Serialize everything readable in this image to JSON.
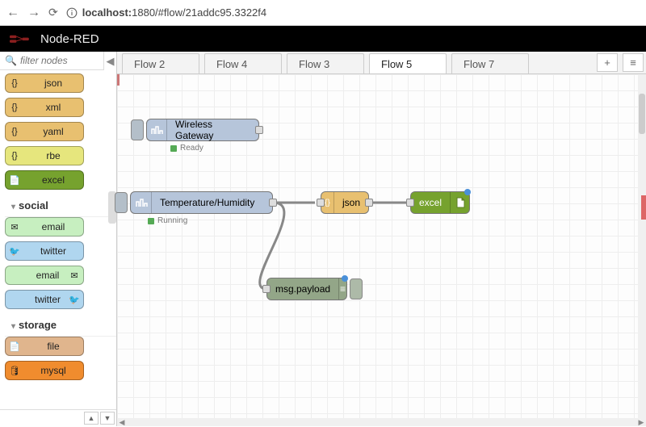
{
  "browser": {
    "url_prefix": "localhost:",
    "url_rest": "1880/#flow/21addc95.3322f4"
  },
  "app": {
    "title": "Node-RED"
  },
  "palette": {
    "search_placeholder": "filter nodes",
    "nodes1": [
      {
        "label": "json",
        "color": "#e8c070"
      },
      {
        "label": "xml",
        "color": "#e8c070"
      },
      {
        "label": "yaml",
        "color": "#e8c070"
      },
      {
        "label": "rbe",
        "color": "#e6e67d"
      },
      {
        "label": "excel",
        "color": "#76a22e"
      }
    ],
    "cat_social": "social",
    "social": [
      {
        "label": "email",
        "dir": "out",
        "color": "#c7efc0"
      },
      {
        "label": "twitter",
        "dir": "out",
        "color": "#b0d6ef"
      },
      {
        "label": "email",
        "dir": "in",
        "color": "#c7efc0"
      },
      {
        "label": "twitter",
        "dir": "in",
        "color": "#b0d6ef"
      }
    ],
    "cat_storage": "storage",
    "storage": [
      {
        "label": "file",
        "color": "#e0b58d"
      },
      {
        "label": "mysql",
        "color": "#f08c2e"
      }
    ]
  },
  "tabs": {
    "list": [
      {
        "label": "Flow 2",
        "active": false
      },
      {
        "label": "Flow 4",
        "active": false
      },
      {
        "label": "Flow 3",
        "active": false
      },
      {
        "label": "Flow 5",
        "active": true
      },
      {
        "label": "Flow 7",
        "active": false
      }
    ]
  },
  "flow": {
    "gateway": {
      "label": "Wireless Gateway",
      "status": "Ready"
    },
    "temp": {
      "label": "Temperature/Humidity",
      "status": "Running"
    },
    "json": {
      "label": "json"
    },
    "excel": {
      "label": "excel"
    },
    "debug": {
      "label": "msg.payload"
    }
  }
}
